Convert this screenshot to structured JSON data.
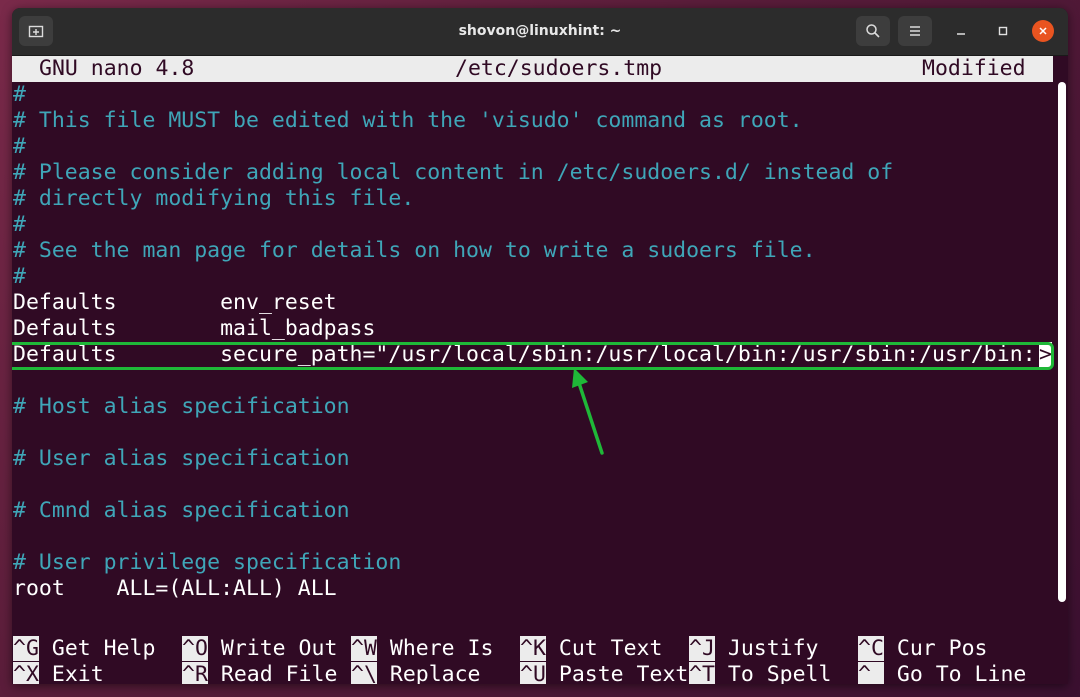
{
  "window": {
    "title": "shovon@linuxhint: ~"
  },
  "nano": {
    "program": "GNU nano 4.8",
    "filename": "/etc/sudoers.tmp",
    "status": "Modified"
  },
  "lines": [
    {
      "text": "#",
      "type": "comment"
    },
    {
      "text": "# This file MUST be edited with the 'visudo' command as root.",
      "type": "comment"
    },
    {
      "text": "#",
      "type": "comment"
    },
    {
      "text": "# Please consider adding local content in /etc/sudoers.d/ instead of",
      "type": "comment"
    },
    {
      "text": "# directly modifying this file.",
      "type": "comment"
    },
    {
      "text": "#",
      "type": "comment"
    },
    {
      "text": "# See the man page for details on how to write a sudoers file.",
      "type": "comment"
    },
    {
      "text": "#",
      "type": "comment"
    },
    {
      "text": "Defaults        env_reset",
      "type": "code"
    },
    {
      "text": "Defaults        mail_badpass",
      "type": "code"
    },
    {
      "text": "Defaults        secure_path=\"/usr/local/sbin:/usr/local/bin:/usr/sbin:/usr/bin:",
      "type": "code"
    },
    {
      "text": "",
      "type": "code"
    },
    {
      "text": "# Host alias specification",
      "type": "comment"
    },
    {
      "text": "",
      "type": "code"
    },
    {
      "text": "# User alias specification",
      "type": "comment"
    },
    {
      "text": "",
      "type": "code"
    },
    {
      "text": "# Cmnd alias specification",
      "type": "comment"
    },
    {
      "text": "",
      "type": "code"
    },
    {
      "text": "# User privilege specification",
      "type": "comment"
    },
    {
      "text": "root    ALL=(ALL:ALL) ALL",
      "type": "code"
    }
  ],
  "cursor_char": ">",
  "shortcuts": [
    [
      {
        "key": "^G",
        "label": "Get Help"
      },
      {
        "key": "^X",
        "label": "Exit"
      }
    ],
    [
      {
        "key": "^O",
        "label": "Write Out"
      },
      {
        "key": "^R",
        "label": "Read File"
      }
    ],
    [
      {
        "key": "^W",
        "label": "Where Is"
      },
      {
        "key": "^\\",
        "label": "Replace"
      }
    ],
    [
      {
        "key": "^K",
        "label": "Cut Text"
      },
      {
        "key": "^U",
        "label": "Paste Text"
      }
    ],
    [
      {
        "key": "^J",
        "label": "Justify"
      },
      {
        "key": "^T",
        "label": "To Spell"
      }
    ],
    [
      {
        "key": "^C",
        "label": "Cur Pos"
      },
      {
        "key": "^_",
        "label": "Go To Line"
      }
    ]
  ],
  "colors": {
    "terminal_bg": "#300a24",
    "comment": "#3fa6b8",
    "highlight": "#1fb838"
  },
  "icons": {
    "new_tab": "new-tab-icon",
    "search": "search-icon",
    "menu": "hamburger-menu-icon",
    "minimize": "minimize-icon",
    "maximize": "maximize-icon",
    "close": "close-icon"
  }
}
